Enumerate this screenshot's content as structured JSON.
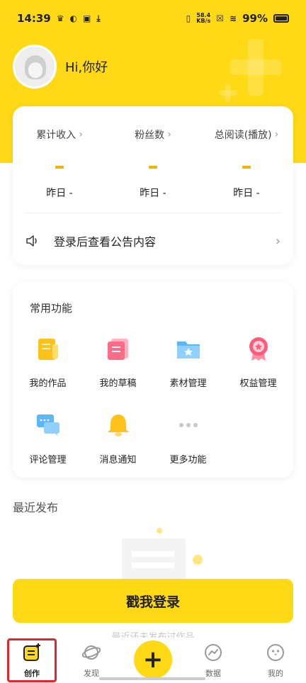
{
  "status_bar": {
    "time": "14:39",
    "net_speed_value": "58.4",
    "net_speed_unit": "KB/s",
    "battery_percent": "99%"
  },
  "profile": {
    "greeting": "Hi,你好"
  },
  "stats": [
    {
      "title": "累计收入",
      "value": "-",
      "yesterday": "昨日 -"
    },
    {
      "title": "粉丝数",
      "value": "-",
      "yesterday": "昨日 -"
    },
    {
      "title": "总阅读(播放)",
      "value": "-",
      "yesterday": "昨日 -"
    }
  ],
  "notice": {
    "text": "登录后查看公告内容"
  },
  "functions": {
    "title": "常用功能",
    "items": [
      {
        "label": "我的作品",
        "icon": "works-icon"
      },
      {
        "label": "我的草稿",
        "icon": "drafts-icon"
      },
      {
        "label": "素材管理",
        "icon": "folder-icon"
      },
      {
        "label": "权益管理",
        "icon": "medal-icon"
      },
      {
        "label": "评论管理",
        "icon": "comment-icon"
      },
      {
        "label": "消息通知",
        "icon": "bell-icon"
      },
      {
        "label": "更多功能",
        "icon": "more-icon"
      }
    ]
  },
  "recent": {
    "title": "最近发布",
    "empty_text": "最近还未发布过作品"
  },
  "login_button": "戳我登录",
  "tabbar": {
    "items": [
      {
        "label": "创作",
        "icon": "create-icon"
      },
      {
        "label": "发现",
        "icon": "planet-icon"
      },
      {
        "label": "",
        "icon": "plus-icon"
      },
      {
        "label": "数据",
        "icon": "chart-icon"
      },
      {
        "label": "我的",
        "icon": "penguin-icon"
      }
    ],
    "plus_glyph": "+"
  },
  "colors": {
    "brand_yellow": "#ffd915",
    "highlight_red": "#e0262c"
  }
}
